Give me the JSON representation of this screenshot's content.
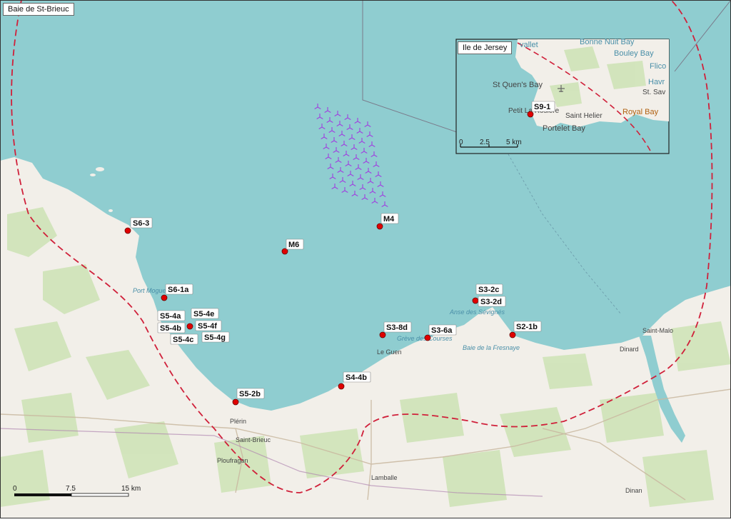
{
  "map": {
    "title": "Baie de St-Brieuc",
    "colors": {
      "sea": "#8fcdd0",
      "land": "#f2efe9",
      "field": "#d8e8c8",
      "boundary": "#d0203a",
      "station": "#e00000",
      "turbine": "#a040e0"
    }
  },
  "stations": [
    {
      "id": "S6-3"
    },
    {
      "id": "M6"
    },
    {
      "id": "M4"
    },
    {
      "id": "S6-1a"
    },
    {
      "id": "S5-4a"
    },
    {
      "id": "S5-4e"
    },
    {
      "id": "S5-4b"
    },
    {
      "id": "S5-4f"
    },
    {
      "id": "S5-4c"
    },
    {
      "id": "S5-4g"
    },
    {
      "id": "S5-2b"
    },
    {
      "id": "S4-4b"
    },
    {
      "id": "S3-8d"
    },
    {
      "id": "S3-6a"
    },
    {
      "id": "S3-2c"
    },
    {
      "id": "S3-2d"
    },
    {
      "id": "S2-1b"
    }
  ],
  "places": {
    "saint_malo": "Saint-Malo",
    "dinard": "Dinard",
    "plerin": "Plérin",
    "saint_brieuc": "Saint-Brieuc",
    "ploufragan": "Ploufragan",
    "lamballe": "Lamballe",
    "dinan": "Dinan",
    "port_moguer": "Port Moguer",
    "anse_sevignes": "Anse des Sévignés",
    "baie_fresnaye": "Baie de la Fresnaye",
    "greve_courses": "Grève des Courses",
    "le_guen": "Le Guen"
  },
  "scale": {
    "labels": [
      "0",
      "7.5",
      "15 km"
    ]
  },
  "inset": {
    "title": "Ile de Jersey",
    "station": "S9-1",
    "places": {
      "st_ouens_bay": "St Quen's Bay",
      "bouley_bay": "Bouley Bay",
      "bonne_nuit_bay": "Bonne Nuit Bay",
      "saint_helier": "Saint Helier",
      "royal_bay": "Royal Bay",
      "portelet_bay": "Portelet Bay",
      "petit_la_rosiere": "Petit La Rosière",
      "st_saviour": "St. Sav",
      "havre": "Havr",
      "flico": "Flico",
      "vallet": "vallet"
    },
    "scale": {
      "labels": [
        "0",
        "2.5",
        "5 km"
      ]
    }
  }
}
